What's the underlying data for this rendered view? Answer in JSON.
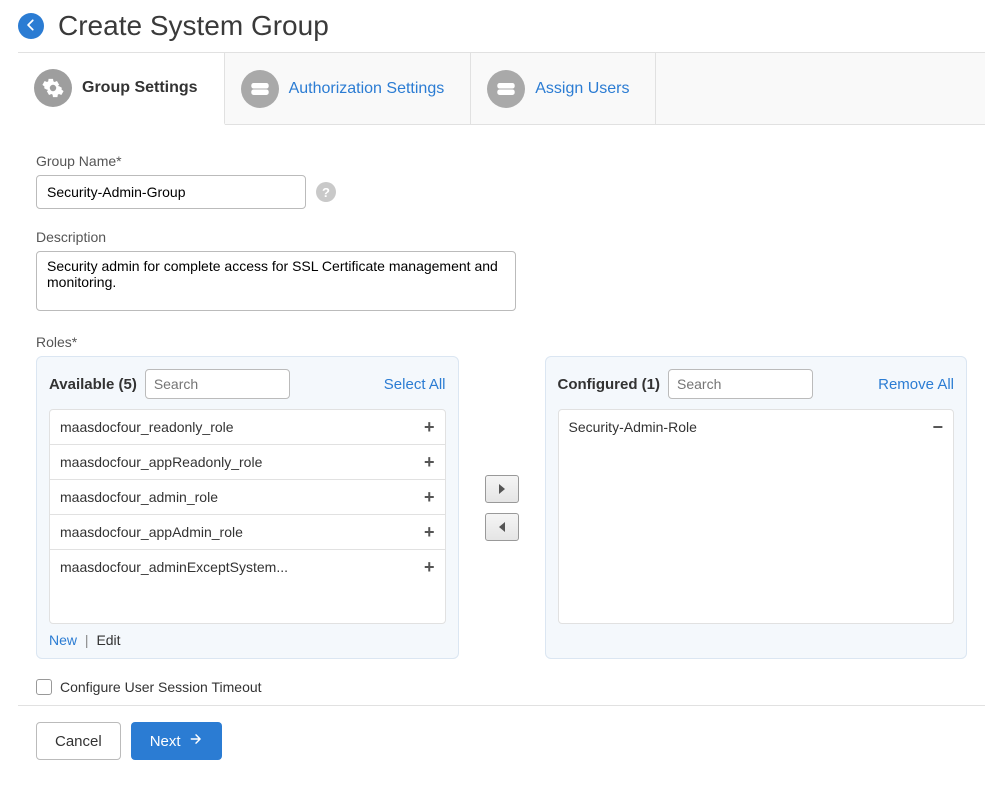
{
  "header": {
    "title": "Create System Group"
  },
  "tabs": {
    "group_settings": "Group Settings",
    "authorization_settings": "Authorization Settings",
    "assign_users": "Assign Users"
  },
  "fields": {
    "group_name_label": "Group Name*",
    "group_name_value": "Security-Admin-Group",
    "description_label": "Description",
    "description_value": "Security admin for complete access for SSL Certificate management and monitoring.",
    "roles_label": "Roles*"
  },
  "roles": {
    "available": {
      "title": "Available (5)",
      "search_placeholder": "Search",
      "select_all": "Select All",
      "items": [
        "maasdocfour_readonly_role",
        "maasdocfour_appReadonly_role",
        "maasdocfour_admin_role",
        "maasdocfour_appAdmin_role",
        "maasdocfour_adminExceptSystem..."
      ],
      "foot_new": "New",
      "foot_edit": "Edit"
    },
    "configured": {
      "title": "Configured (1)",
      "search_placeholder": "Search",
      "remove_all": "Remove All",
      "items": [
        "Security-Admin-Role"
      ]
    }
  },
  "checkbox": {
    "label": "Configure User Session Timeout"
  },
  "buttons": {
    "cancel": "Cancel",
    "next": "Next"
  }
}
